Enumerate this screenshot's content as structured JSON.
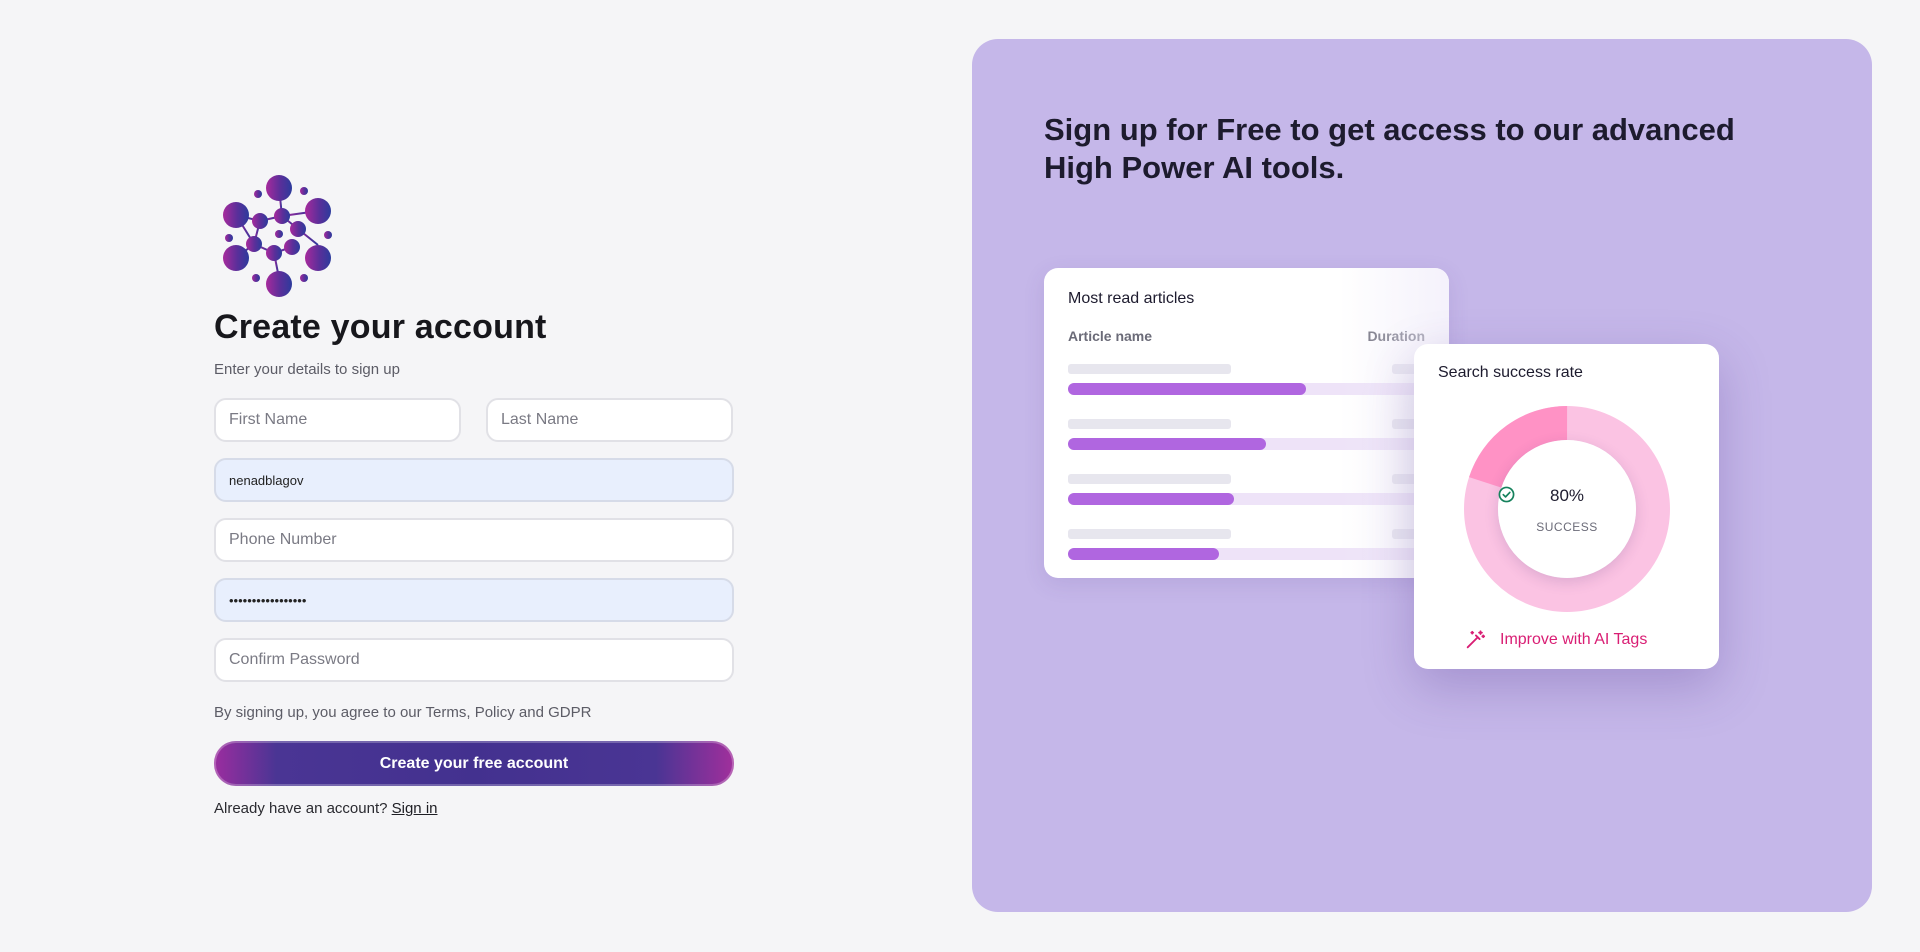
{
  "form": {
    "title": "Create your account",
    "subtitle": "Enter your details to sign up",
    "first_name_placeholder": "First Name",
    "last_name_placeholder": "Last Name",
    "username_value": "nenadblagov",
    "phone_placeholder": "Phone Number",
    "password_value": "•••••••••••••••••",
    "confirm_password_placeholder": "Confirm Password",
    "terms_text": "By signing up, you agree to our Terms, Policy and GDPR",
    "submit_label": "Create your free account",
    "signin_prompt": "Already have an account?",
    "signin_link": "Sign in"
  },
  "promo": {
    "headline": "Sign up for Free to get access to our advanced High Power AI tools.",
    "articles_card": {
      "title": "Most read articles",
      "col_name": "Article name",
      "col_duration": "Duration",
      "rows": [
        {
          "progress": 0.66
        },
        {
          "progress": 0.55
        },
        {
          "progress": 0.46
        },
        {
          "progress": 0.42
        }
      ]
    },
    "rate_card": {
      "title": "Search success rate",
      "percent_text": "80%",
      "percent_value": 80,
      "status": "SUCCESS",
      "action_label": "Improve with AI Tags"
    }
  },
  "colors": {
    "panel_bg": "#c5b7e9",
    "bar_fill": "#b066e0",
    "donut_main": "#fbc3e3",
    "donut_accent": "#ff92c5",
    "accent_pink": "#d91e74",
    "check_green": "#16825d"
  },
  "icons": {
    "logo": "molecule-dots-logo",
    "success": "check-circle-icon",
    "action": "magic-wand-icon"
  }
}
